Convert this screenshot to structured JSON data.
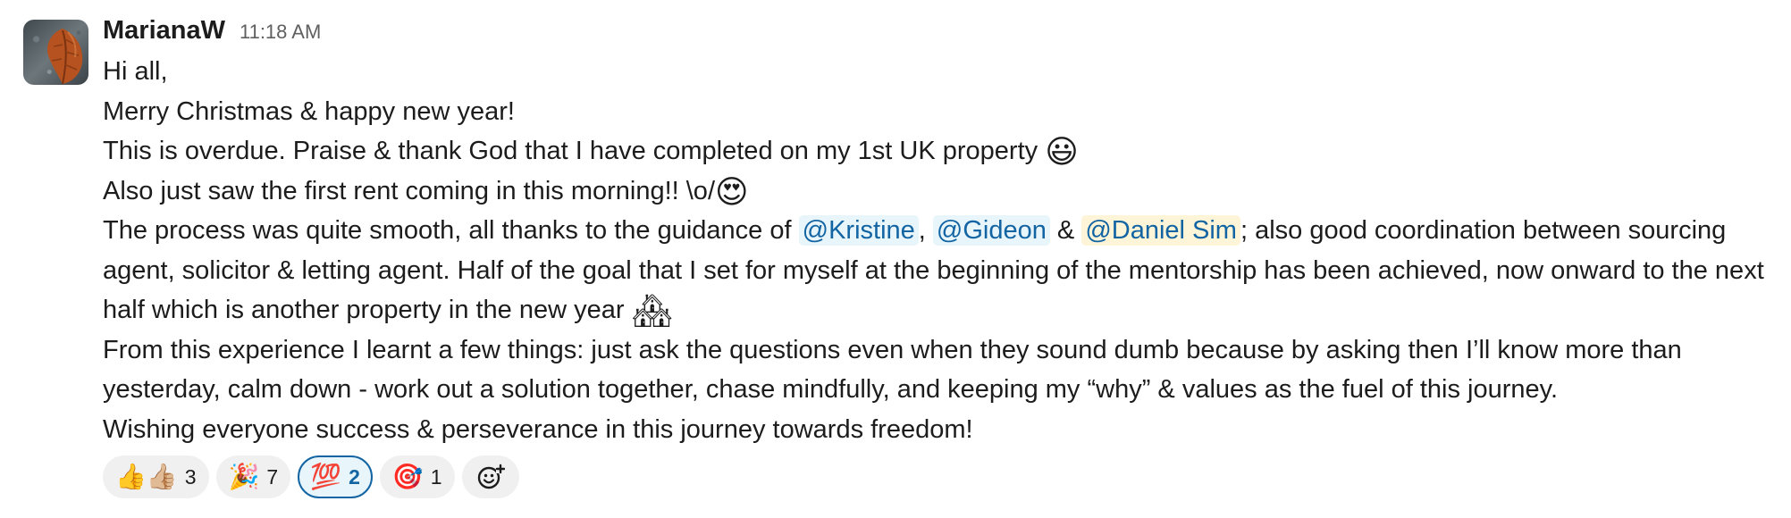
{
  "message": {
    "sender": "MarianaW",
    "timestamp": "11:18 AM",
    "lines": {
      "l1": "Hi all,",
      "l2": "Merry Christmas & happy new year!",
      "l3": "This is overdue. Praise & thank God that I have completed on my 1st UK property",
      "l3_emoji": "😃",
      "l4": "Also just saw the first rent coming in this morning!! \\o/",
      "l4_emoji": "😍",
      "l5_pre": "The process was quite smooth, all thanks to the guidance of ",
      "mention1": "@Kristine",
      "sep1": ", ",
      "mention2": "@Gideon",
      "sep2": " & ",
      "mention3": "@Daniel Sim",
      "l5_post": "; also good coordination between sourcing agent, solicitor & letting agent. Half of the goal that I set for myself at the beginning of the mentorship has been achieved, now onward to the next half which is another property in the new year",
      "l5_emoji": "🏘",
      "l6": "From this experience I learnt a few things: just ask the questions even when they sound dumb because by asking then I’ll know more than yesterday, calm down - work out a solution together, chase mindfully, and keeping my “why” & values as the fuel of this journey.",
      "l7": "Wishing everyone success & perseverance in this journey towards freedom!"
    }
  },
  "reactions": [
    {
      "emoji": "👍👍🏼",
      "count": "3",
      "active": false
    },
    {
      "emoji": "🎉",
      "count": "7",
      "active": false
    },
    {
      "emoji": "💯",
      "count": "2",
      "active": true
    },
    {
      "emoji": "🎯",
      "count": "1",
      "active": false
    }
  ],
  "add_reaction_icon": "add-emoji-icon",
  "colors": {
    "mention_text": "#1264a3",
    "mention_bg": "#e8f5fa",
    "mention_self_bg": "#fef4d8",
    "active_reaction_border": "#1264a3"
  }
}
